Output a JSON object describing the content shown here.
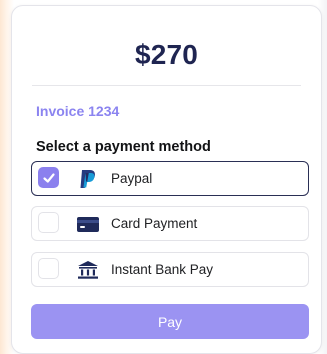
{
  "payment": {
    "amount": "$270",
    "invoice": "Invoice 1234",
    "section_title": "Select a payment method",
    "methods": [
      {
        "label": "Paypal",
        "icon": "paypal-icon",
        "selected": true
      },
      {
        "label": "Card Payment",
        "icon": "credit-card-icon",
        "selected": false
      },
      {
        "label": "Instant Bank Pay",
        "icon": "bank-icon",
        "selected": false
      }
    ],
    "pay_button": "Pay"
  },
  "colors": {
    "accent": "#8b80ee",
    "button": "#9b93f2",
    "amount_text": "#1f2551",
    "invoice_text": "#8b84f0"
  }
}
